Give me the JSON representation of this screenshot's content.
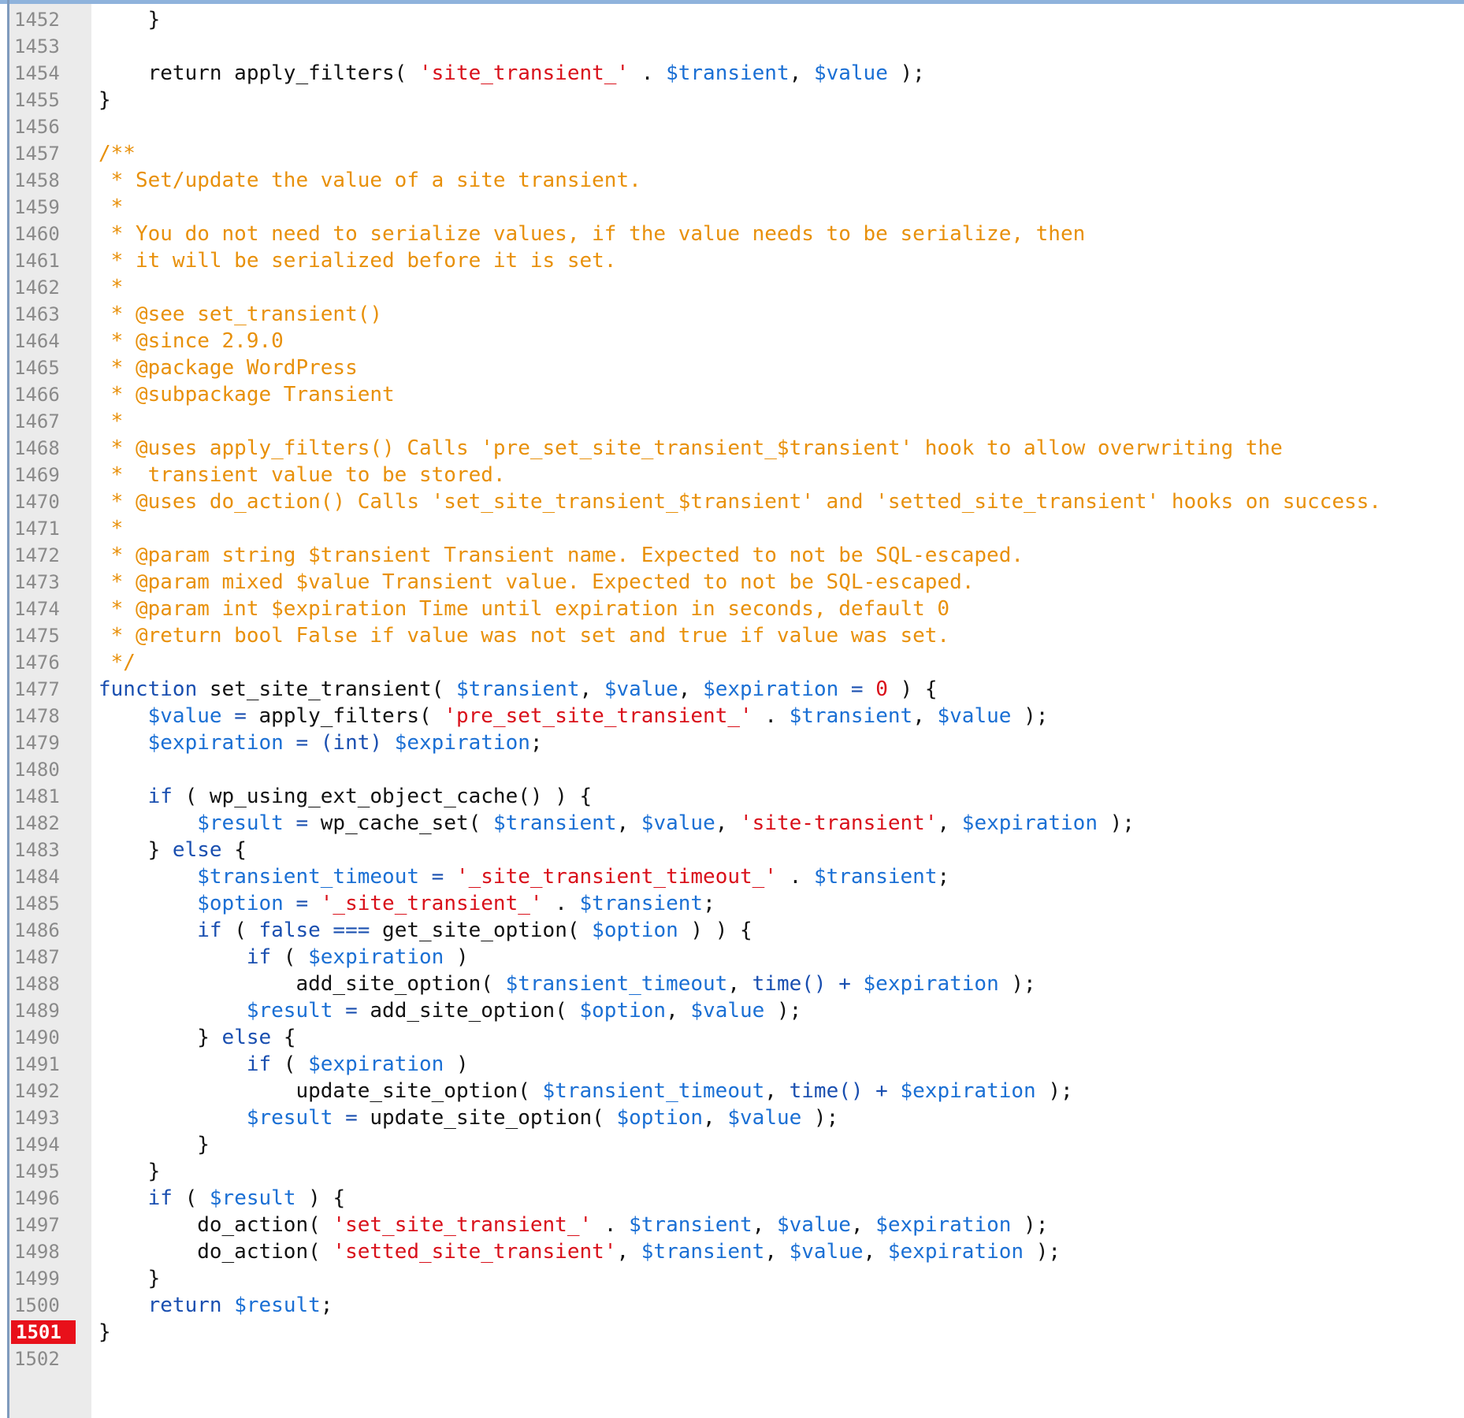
{
  "editor": {
    "active_line": 1501,
    "lines": [
      {
        "n": "1452",
        "t": [
          [
            "pl",
            "    }"
          ]
        ]
      },
      {
        "n": "1453",
        "t": []
      },
      {
        "n": "1454",
        "t": [
          [
            "pl",
            "    return apply_filters( "
          ],
          [
            "str",
            "'site_transient_'"
          ],
          [
            "pl",
            " . "
          ],
          [
            "var",
            "$transient"
          ],
          [
            "pl",
            ", "
          ],
          [
            "var",
            "$value"
          ],
          [
            "pl",
            " );"
          ]
        ]
      },
      {
        "n": "1455",
        "t": [
          [
            "pl",
            "}"
          ]
        ]
      },
      {
        "n": "1456",
        "t": []
      },
      {
        "n": "1457",
        "t": [
          [
            "cm",
            "/**"
          ]
        ]
      },
      {
        "n": "1458",
        "t": [
          [
            "cm",
            " * Set/update the value of a site transient."
          ]
        ]
      },
      {
        "n": "1459",
        "t": [
          [
            "cm",
            " *"
          ]
        ]
      },
      {
        "n": "1460",
        "t": [
          [
            "cm",
            " * You do not need to serialize values, if the value needs to be serialize, then"
          ]
        ]
      },
      {
        "n": "1461",
        "t": [
          [
            "cm",
            " * it will be serialized before it is set."
          ]
        ]
      },
      {
        "n": "1462",
        "t": [
          [
            "cm",
            " *"
          ]
        ]
      },
      {
        "n": "1463",
        "t": [
          [
            "cm",
            " * @see set_transient()"
          ]
        ]
      },
      {
        "n": "1464",
        "t": [
          [
            "cm",
            " * @since 2.9.0"
          ]
        ]
      },
      {
        "n": "1465",
        "t": [
          [
            "cm",
            " * @package WordPress"
          ]
        ]
      },
      {
        "n": "1466",
        "t": [
          [
            "cm",
            " * @subpackage Transient"
          ]
        ]
      },
      {
        "n": "1467",
        "t": [
          [
            "cm",
            " *"
          ]
        ]
      },
      {
        "n": "1468",
        "t": [
          [
            "cm",
            " * @uses apply_filters() Calls 'pre_set_site_transient_$transient' hook to allow overwriting the"
          ]
        ]
      },
      {
        "n": "1469",
        "t": [
          [
            "cm",
            " *  transient value to be stored."
          ]
        ]
      },
      {
        "n": "1470",
        "t": [
          [
            "cm",
            " * @uses do_action() Calls 'set_site_transient_$transient' and 'setted_site_transient' hooks on success."
          ]
        ]
      },
      {
        "n": "1471",
        "t": [
          [
            "cm",
            " *"
          ]
        ]
      },
      {
        "n": "1472",
        "t": [
          [
            "cm",
            " * @param string $transient Transient name. Expected to not be SQL-escaped."
          ]
        ]
      },
      {
        "n": "1473",
        "t": [
          [
            "cm",
            " * @param mixed $value Transient value. Expected to not be SQL-escaped."
          ]
        ]
      },
      {
        "n": "1474",
        "t": [
          [
            "cm",
            " * @param int $expiration Time until expiration in seconds, default 0"
          ]
        ]
      },
      {
        "n": "1475",
        "t": [
          [
            "cm",
            " * @return bool False if value was not set and true if value was set."
          ]
        ]
      },
      {
        "n": "1476",
        "t": [
          [
            "cm",
            " */"
          ]
        ]
      },
      {
        "n": "1477",
        "t": [
          [
            "kw",
            "function"
          ],
          [
            "pl",
            " set_site_transient( "
          ],
          [
            "var",
            "$transient"
          ],
          [
            "pl",
            ", "
          ],
          [
            "var",
            "$value"
          ],
          [
            "pl",
            ", "
          ],
          [
            "var",
            "$expiration"
          ],
          [
            "kw",
            " = "
          ],
          [
            "num",
            "0"
          ],
          [
            "pl",
            " ) {"
          ]
        ]
      },
      {
        "n": "1478",
        "t": [
          [
            "pl",
            "    "
          ],
          [
            "var",
            "$value"
          ],
          [
            "kw",
            " = "
          ],
          [
            "pl",
            "apply_filters( "
          ],
          [
            "str",
            "'pre_set_site_transient_'"
          ],
          [
            "pl",
            " . "
          ],
          [
            "var",
            "$transient"
          ],
          [
            "pl",
            ", "
          ],
          [
            "var",
            "$value"
          ],
          [
            "pl",
            " );"
          ]
        ]
      },
      {
        "n": "1479",
        "t": [
          [
            "pl",
            "    "
          ],
          [
            "var",
            "$expiration"
          ],
          [
            "kw",
            " = (int) "
          ],
          [
            "var",
            "$expiration"
          ],
          [
            "pl",
            ";"
          ]
        ]
      },
      {
        "n": "1480",
        "t": []
      },
      {
        "n": "1481",
        "t": [
          [
            "pl",
            "    "
          ],
          [
            "kw",
            "if"
          ],
          [
            "pl",
            " ( wp_using_ext_object_cache() ) {"
          ]
        ]
      },
      {
        "n": "1482",
        "t": [
          [
            "pl",
            "        "
          ],
          [
            "var",
            "$result"
          ],
          [
            "kw",
            " = "
          ],
          [
            "pl",
            "wp_cache_set( "
          ],
          [
            "var",
            "$transient"
          ],
          [
            "pl",
            ", "
          ],
          [
            "var",
            "$value"
          ],
          [
            "pl",
            ", "
          ],
          [
            "str",
            "'site-transient'"
          ],
          [
            "pl",
            ", "
          ],
          [
            "var",
            "$expiration"
          ],
          [
            "pl",
            " );"
          ]
        ]
      },
      {
        "n": "1483",
        "t": [
          [
            "pl",
            "    } "
          ],
          [
            "kw",
            "else"
          ],
          [
            "pl",
            " {"
          ]
        ]
      },
      {
        "n": "1484",
        "t": [
          [
            "pl",
            "        "
          ],
          [
            "var",
            "$transient_timeout"
          ],
          [
            "kw",
            " = "
          ],
          [
            "str",
            "'_site_transient_timeout_'"
          ],
          [
            "pl",
            " . "
          ],
          [
            "var",
            "$transient"
          ],
          [
            "pl",
            ";"
          ]
        ]
      },
      {
        "n": "1485",
        "t": [
          [
            "pl",
            "        "
          ],
          [
            "var",
            "$option"
          ],
          [
            "kw",
            " = "
          ],
          [
            "str",
            "'_site_transient_'"
          ],
          [
            "pl",
            " . "
          ],
          [
            "var",
            "$transient"
          ],
          [
            "pl",
            ";"
          ]
        ]
      },
      {
        "n": "1486",
        "t": [
          [
            "pl",
            "        "
          ],
          [
            "kw",
            "if"
          ],
          [
            "pl",
            " ( "
          ],
          [
            "kw",
            "false ==="
          ],
          [
            "pl",
            " get_site_option( "
          ],
          [
            "var",
            "$option"
          ],
          [
            "pl",
            " ) ) {"
          ]
        ]
      },
      {
        "n": "1487",
        "t": [
          [
            "pl",
            "            "
          ],
          [
            "kw",
            "if"
          ],
          [
            "pl",
            " ( "
          ],
          [
            "var",
            "$expiration"
          ],
          [
            "pl",
            " )"
          ]
        ]
      },
      {
        "n": "1488",
        "t": [
          [
            "pl",
            "                add_site_option( "
          ],
          [
            "var",
            "$transient_timeout"
          ],
          [
            "pl",
            ", "
          ],
          [
            "kw",
            "time()"
          ],
          [
            "kw",
            " + "
          ],
          [
            "var",
            "$expiration"
          ],
          [
            "pl",
            " );"
          ]
        ]
      },
      {
        "n": "1489",
        "t": [
          [
            "pl",
            "            "
          ],
          [
            "var",
            "$result"
          ],
          [
            "kw",
            " = "
          ],
          [
            "pl",
            "add_site_option( "
          ],
          [
            "var",
            "$option"
          ],
          [
            "pl",
            ", "
          ],
          [
            "var",
            "$value"
          ],
          [
            "pl",
            " );"
          ]
        ]
      },
      {
        "n": "1490",
        "t": [
          [
            "pl",
            "        } "
          ],
          [
            "kw",
            "else"
          ],
          [
            "pl",
            " {"
          ]
        ]
      },
      {
        "n": "1491",
        "t": [
          [
            "pl",
            "            "
          ],
          [
            "kw",
            "if"
          ],
          [
            "pl",
            " ( "
          ],
          [
            "var",
            "$expiration"
          ],
          [
            "pl",
            " )"
          ]
        ]
      },
      {
        "n": "1492",
        "t": [
          [
            "pl",
            "                update_site_option( "
          ],
          [
            "var",
            "$transient_timeout"
          ],
          [
            "pl",
            ", "
          ],
          [
            "kw",
            "time()"
          ],
          [
            "kw",
            " + "
          ],
          [
            "var",
            "$expiration"
          ],
          [
            "pl",
            " );"
          ]
        ]
      },
      {
        "n": "1493",
        "t": [
          [
            "pl",
            "            "
          ],
          [
            "var",
            "$result"
          ],
          [
            "kw",
            " = "
          ],
          [
            "pl",
            "update_site_option( "
          ],
          [
            "var",
            "$option"
          ],
          [
            "pl",
            ", "
          ],
          [
            "var",
            "$value"
          ],
          [
            "pl",
            " );"
          ]
        ]
      },
      {
        "n": "1494",
        "t": [
          [
            "pl",
            "        }"
          ]
        ]
      },
      {
        "n": "1495",
        "t": [
          [
            "pl",
            "    }"
          ]
        ]
      },
      {
        "n": "1496",
        "t": [
          [
            "pl",
            "    "
          ],
          [
            "kw",
            "if"
          ],
          [
            "pl",
            " ( "
          ],
          [
            "var",
            "$result"
          ],
          [
            "pl",
            " ) {"
          ]
        ]
      },
      {
        "n": "1497",
        "t": [
          [
            "pl",
            "        do_action( "
          ],
          [
            "str",
            "'set_site_transient_'"
          ],
          [
            "pl",
            " . "
          ],
          [
            "var",
            "$transient"
          ],
          [
            "pl",
            ", "
          ],
          [
            "var",
            "$value"
          ],
          [
            "pl",
            ", "
          ],
          [
            "var",
            "$expiration"
          ],
          [
            "pl",
            " );"
          ]
        ]
      },
      {
        "n": "1498",
        "t": [
          [
            "pl",
            "        do_action( "
          ],
          [
            "str",
            "'setted_site_transient'"
          ],
          [
            "pl",
            ", "
          ],
          [
            "var",
            "$transient"
          ],
          [
            "pl",
            ", "
          ],
          [
            "var",
            "$value"
          ],
          [
            "pl",
            ", "
          ],
          [
            "var",
            "$expiration"
          ],
          [
            "pl",
            " );"
          ]
        ]
      },
      {
        "n": "1499",
        "t": [
          [
            "pl",
            "    }"
          ]
        ]
      },
      {
        "n": "1500",
        "t": [
          [
            "pl",
            "    "
          ],
          [
            "kw",
            "return"
          ],
          [
            "pl",
            " "
          ],
          [
            "var",
            "$result"
          ],
          [
            "pl",
            ";"
          ]
        ]
      },
      {
        "n": "1501",
        "t": [
          [
            "pl",
            "}"
          ]
        ]
      },
      {
        "n": "1502",
        "t": []
      }
    ]
  },
  "colors": {
    "keyword": "#1a4fb0",
    "variable": "#1a6fd4",
    "string": "#d9101a",
    "comment": "#e8900a",
    "active_line_number_bg": "#e8101a",
    "gutter_bg": "#ebebeb"
  }
}
